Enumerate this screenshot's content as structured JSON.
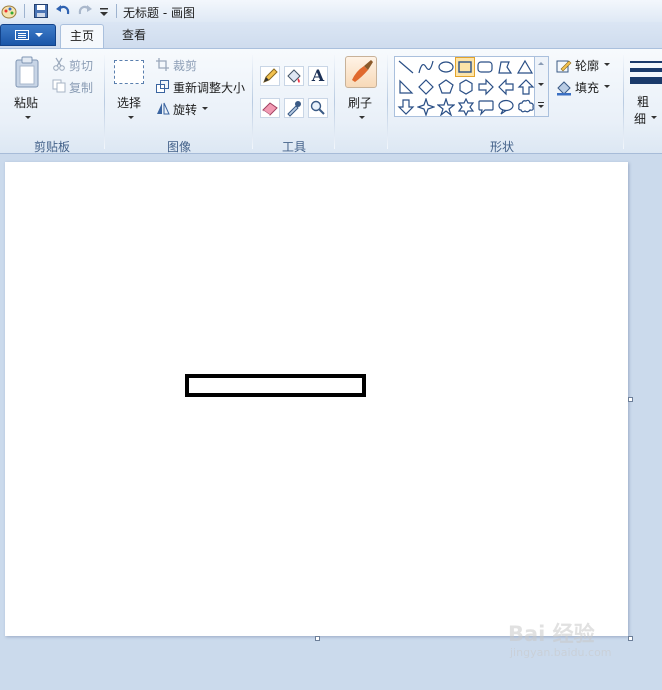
{
  "titlebar": {
    "title": "无标题 - 画图"
  },
  "tabs": {
    "home": "主页",
    "view": "查看"
  },
  "clipboard": {
    "paste": "粘贴",
    "cut": "剪切",
    "copy": "复制",
    "group": "剪贴板"
  },
  "image": {
    "select": "选择",
    "crop": "裁剪",
    "resize": "重新调整大小",
    "rotate": "旋转",
    "group": "图像"
  },
  "tools": {
    "group": "工具",
    "text_glyph": "A"
  },
  "brushes": {
    "label": "刷子"
  },
  "shapes": {
    "outline": "轮廓",
    "fill": "填充",
    "group": "形状",
    "items": [
      "line-icon",
      "curve-icon",
      "oval-icon",
      "rectangle-icon",
      "rounded-rectangle-icon",
      "polygon-icon",
      "triangle-icon",
      "right-triangle-icon",
      "diamond-icon",
      "pentagon-icon",
      "hexagon-icon",
      "right-arrow-icon",
      "left-arrow-icon",
      "up-arrow-icon",
      "down-arrow-icon",
      "four-point-star-icon",
      "five-point-star-icon",
      "six-point-star-icon",
      "rounded-callout-icon",
      "oval-callout-icon",
      "cloud-callout-icon"
    ],
    "selected": "rectangle-icon"
  },
  "size": {
    "line1": "粗",
    "line2": "细"
  },
  "watermark": {
    "brand": "Bai 经验",
    "url": "jingyan.baidu.com"
  },
  "colors": {
    "accent": "#1a56a8",
    "ribbon_bg": "#e9f0f8",
    "canvas_bg": "#cbdaec",
    "selected_shape": "#f2b94c"
  }
}
